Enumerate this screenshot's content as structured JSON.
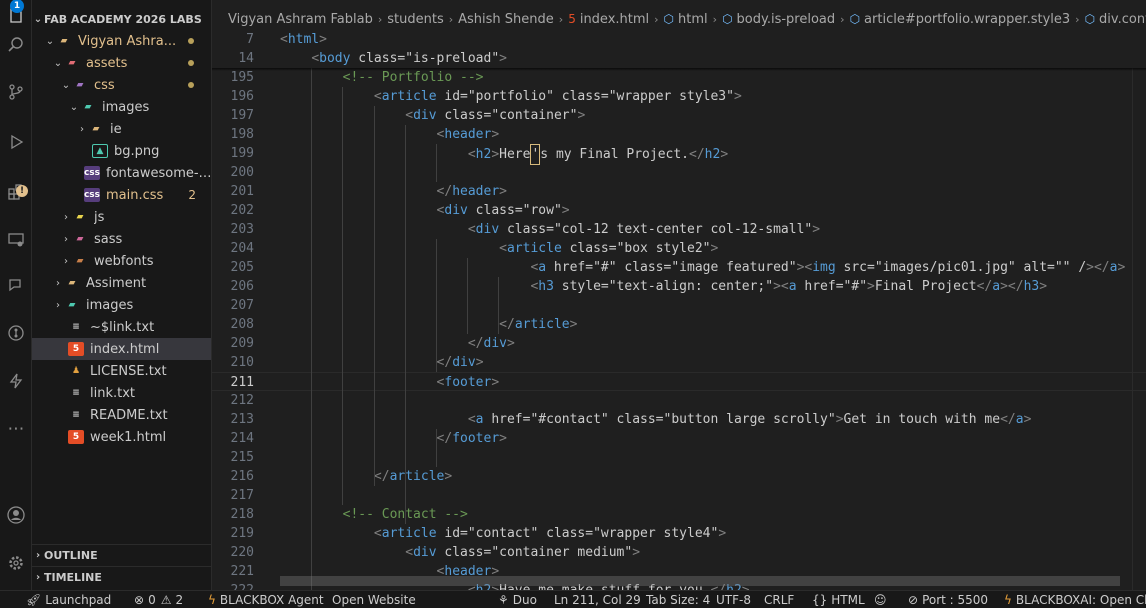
{
  "activity_bar": {
    "explorer_badge": "1",
    "icons": [
      "files-icon",
      "search-icon",
      "source-control-icon",
      "run-debug-icon",
      "extensions-icon",
      "remote-explorer-icon",
      "live-share-icon",
      "git-graph-icon",
      "blackbox-icon",
      "more-icon",
      "account-icon",
      "settings-icon"
    ]
  },
  "sidebar": {
    "workspace_title": "FAB ACADEMY 2026 LABS",
    "tree": [
      {
        "label": "Vigyan Ashra...",
        "decoration": "dot"
      },
      {
        "label": "assets",
        "decoration": "dot"
      },
      {
        "label": "css",
        "decoration": "dot"
      },
      {
        "label": "images"
      },
      {
        "label": "ie"
      },
      {
        "label": "bg.png"
      },
      {
        "label": "fontawesome-al..."
      },
      {
        "label": "main.css",
        "count": "2"
      },
      {
        "label": "js"
      },
      {
        "label": "sass"
      },
      {
        "label": "webfonts"
      },
      {
        "label": "Assiment"
      },
      {
        "label": "images"
      },
      {
        "label": "~$link.txt"
      },
      {
        "label": "index.html"
      },
      {
        "label": "LICENSE.txt"
      },
      {
        "label": "link.txt"
      },
      {
        "label": "README.txt"
      },
      {
        "label": "week1.html"
      }
    ],
    "outline_label": "OUTLINE",
    "timeline_label": "TIMELINE"
  },
  "breadcrumb": [
    "Vigyan Ashram Fablab",
    "students",
    "Ashish Shende",
    "index.html",
    "html",
    "body.is-preload",
    "article#portfolio.wrapper.style3",
    "div.container"
  ],
  "editor": {
    "sticky_lines": [
      {
        "num": "7",
        "code": "<html>"
      },
      {
        "num": "14",
        "code": "    <body class=\"is-preload\">"
      }
    ],
    "lines": [
      {
        "num": "195",
        "code": "        <!-- Portfolio -->"
      },
      {
        "num": "196",
        "code": "            <article id=\"portfolio\" class=\"wrapper style3\">"
      },
      {
        "num": "197",
        "code": "                <div class=\"container\">"
      },
      {
        "num": "198",
        "code": "                    <header>"
      },
      {
        "num": "199",
        "code": "                        <h2>Here's my Final Project.</h2>"
      },
      {
        "num": "200",
        "code": ""
      },
      {
        "num": "201",
        "code": "                    </header>"
      },
      {
        "num": "202",
        "code": "                    <div class=\"row\">"
      },
      {
        "num": "203",
        "code": "                        <div class=\"col-12 text-center col-12-small\">"
      },
      {
        "num": "204",
        "code": "                            <article class=\"box style2\">"
      },
      {
        "num": "205",
        "code": "                                <a href=\"#\" class=\"image featured\"><img src=\"images/pic01.jpg\" alt=\"\" /></a>"
      },
      {
        "num": "206",
        "code": "                                <h3 style=\"text-align: center;\"><a href=\"#\">Final Project</a></h3>"
      },
      {
        "num": "207",
        "code": ""
      },
      {
        "num": "208",
        "code": "                            </article>"
      },
      {
        "num": "209",
        "code": "                        </div>"
      },
      {
        "num": "210",
        "code": "                    </div>"
      },
      {
        "num": "211",
        "code": "                    <footer>"
      },
      {
        "num": "212",
        "code": ""
      },
      {
        "num": "213",
        "code": "                        <a href=\"#contact\" class=\"button large scrolly\">Get in touch with me</a>"
      },
      {
        "num": "214",
        "code": "                    </footer>"
      },
      {
        "num": "215",
        "code": ""
      },
      {
        "num": "216",
        "code": "            </article>"
      },
      {
        "num": "217",
        "code": ""
      },
      {
        "num": "218",
        "code": "        <!-- Contact -->"
      },
      {
        "num": "219",
        "code": "            <article id=\"contact\" class=\"wrapper style4\">"
      },
      {
        "num": "220",
        "code": "                <div class=\"container medium\">"
      },
      {
        "num": "221",
        "code": "                    <header>"
      },
      {
        "num": "222",
        "code": "                        <h2>Have me make stuff for you.</h2>"
      }
    ]
  },
  "status_bar": {
    "launchpad": "Launchpad",
    "errors": "0",
    "warnings": "2",
    "blackbox_agent": "BLACKBOX Agent",
    "open_website": "Open Website",
    "duo": "Duo",
    "cursor_pos": "Ln 211, Col 29",
    "tab_size": "Tab Size: 4",
    "encoding": "UTF-8",
    "eol": "CRLF",
    "language": "HTML",
    "port": "Port : 5500",
    "blackboxai": "BLACKBOXAI: Open Chat"
  }
}
